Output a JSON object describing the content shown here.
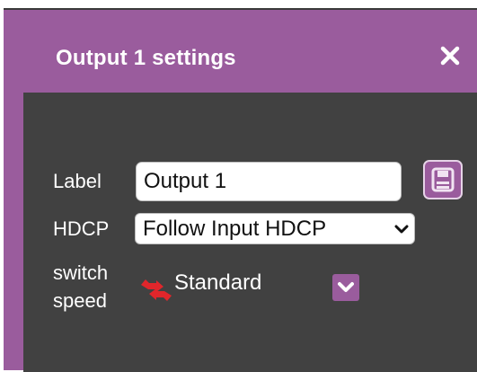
{
  "dialog": {
    "title": "Output 1 settings",
    "close_icon": "close-icon",
    "accent_color": "#9a5c9d",
    "panel_color": "#414141"
  },
  "form": {
    "label_field": {
      "label": "Label",
      "value": "Output 1",
      "save_icon": "save-icon"
    },
    "hdcp_field": {
      "label": "HDCP",
      "selected": "Follow Input HDCP"
    },
    "switch_speed_field": {
      "label_line1": "switch",
      "label_line2": "speed",
      "icon": "switch-speed-icon",
      "value": "Standard",
      "dropdown_icon": "chevron-down-icon"
    }
  }
}
